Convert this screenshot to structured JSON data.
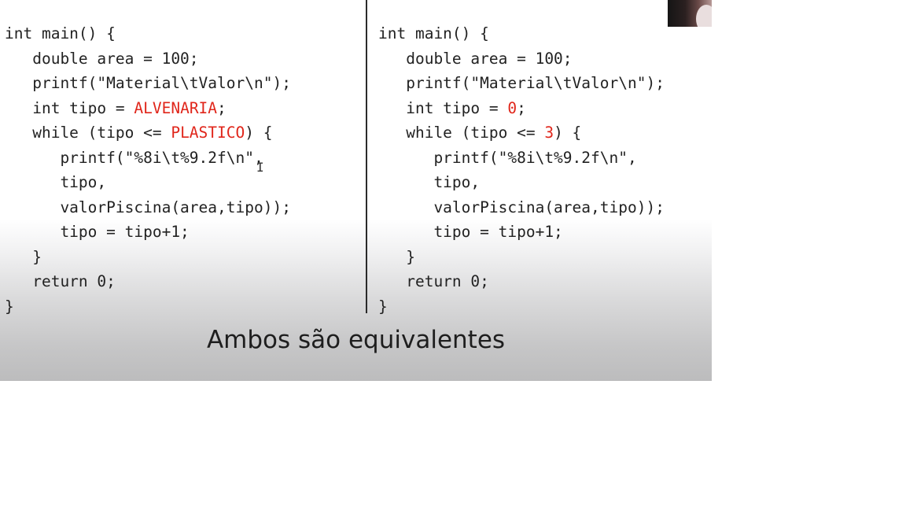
{
  "slide": {
    "left_code": [
      {
        "text": "int main() {"
      },
      {
        "text": "   double area = 100;"
      },
      {
        "text": "   printf(\"Material\\tValor\\n\");"
      },
      {
        "text": "   int tipo = ",
        "hl": "ALVENARIA",
        "after": ";"
      },
      {
        "text": "   while (tipo <= ",
        "hl": "PLASTICO",
        "after": ") {"
      },
      {
        "text": "      printf(\"%8i\\t%9.2f\\n\","
      },
      {
        "text": "      tipo,"
      },
      {
        "text": "      valorPiscina(area,tipo));"
      },
      {
        "text": "      tipo = tipo+1;"
      },
      {
        "text": "   }"
      },
      {
        "text": "   return 0;"
      },
      {
        "text": "}"
      }
    ],
    "right_code": [
      {
        "text": "int main() {"
      },
      {
        "text": "   double area = 100;"
      },
      {
        "text": "   printf(\"Material\\tValor\\n\");"
      },
      {
        "text": "   int tipo = ",
        "hl": "0",
        "after": ";"
      },
      {
        "text": "   while (tipo <= ",
        "hl": "3",
        "after": ") {"
      },
      {
        "text": "      printf(\"%8i\\t%9.2f\\n\","
      },
      {
        "text": "      tipo,"
      },
      {
        "text": "      valorPiscina(area,tipo));"
      },
      {
        "text": "      tipo = tipo+1;"
      },
      {
        "text": "   }"
      },
      {
        "text": "   return 0;"
      },
      {
        "text": "}"
      }
    ],
    "caption": "Ambos são equivalentes"
  },
  "colors": {
    "highlight": "#e0261b",
    "code_text": "#222222"
  },
  "icons": {
    "text_cursor": "I-beam"
  }
}
